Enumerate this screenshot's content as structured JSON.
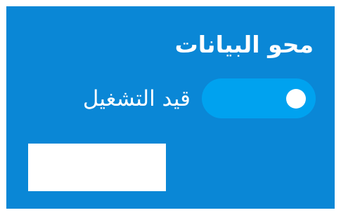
{
  "setting": {
    "title": "محو البيانات",
    "toggle": {
      "state_label": "قيد التشغيل",
      "on": true
    }
  },
  "colors": {
    "panel_background": "#0a87d6",
    "toggle_track": "#00a2ef",
    "toggle_knob": "#ffffff",
    "text": "#ffffff"
  }
}
